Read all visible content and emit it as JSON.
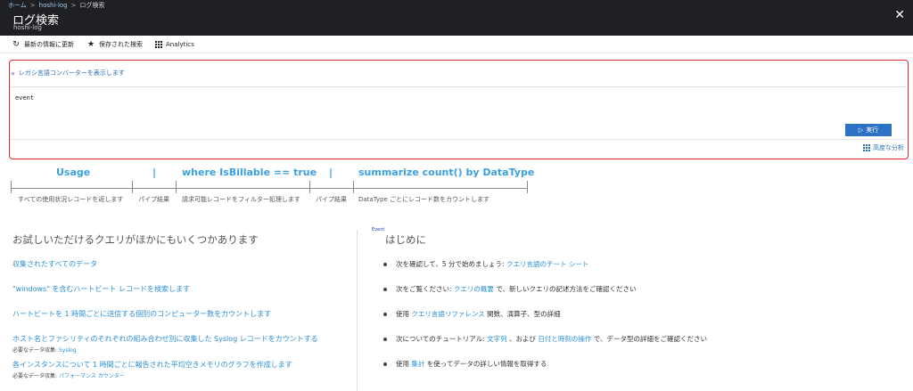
{
  "breadcrumb": {
    "home": "ホーム",
    "sep": ">",
    "workspace": "hoshi-log",
    "current": "ログ検索"
  },
  "header": {
    "title": "ログ検索",
    "subtitle": "hoshi-log",
    "close_icon": "close-icon"
  },
  "toolbar": {
    "refresh_label": "最新の情報に更新",
    "saved_label": "保存された検索",
    "analytics_label": "Analytics"
  },
  "query": {
    "legacy_toggle": "レガシ言語コンバーターを表示します",
    "text": "event",
    "run_label": "実行",
    "advanced_label": "高度な分析"
  },
  "syntax": {
    "parts": [
      "Usage",
      "|",
      "where IsBillable == true",
      "|",
      "summarize count() by DataType"
    ],
    "descriptions": [
      "すべての使用状況レコードを返します",
      "パイプ結果",
      "請求可能レコードをフィルター処理します",
      "パイプ結果",
      "DataType ごとにレコード数をカウントします"
    ]
  },
  "samples": {
    "heading": "お試しいただけるクエリがほかにもいくつかあります",
    "items": [
      {
        "label": "収集されたすべてのデータ"
      },
      {
        "label": "\"windows\" を含むハートビート レコードを検索します"
      },
      {
        "label": "ハートビートを 1 時間ごとに送信する個別のコンピューター数をカウントします"
      },
      {
        "label": "ホスト名とファシリティのそれぞれの組み合わせ別に収集した Syslog レコードをカウントする",
        "req_prefix": "必要なデータ収集:",
        "req_value": "Syslog"
      },
      {
        "label": "各インスタンスについて 1 時間ごとに報告された平均空きメモリのグラフを作成します",
        "req_prefix": "必要なデータ収集:",
        "req_value": "パフォーマンス カウンター"
      }
    ]
  },
  "getting_started": {
    "tag": "Event",
    "heading": "はじめに",
    "items": [
      {
        "pre": "次を確認して、5 分で始めましょう:",
        "link": "クエリ言語のチート シート",
        "post": ""
      },
      {
        "pre": "次をご覧ください:",
        "link": "クエリの概要",
        "post": "で、新しいクエリの記述方法をご確認ください"
      },
      {
        "pre": "使用",
        "link": "クエリ言語リファレンス",
        "post": "関数、演算子、型の詳細"
      },
      {
        "pre": "次についてのチュートリアル:",
        "link": "文字列",
        "mid": "、および",
        "link2": "日付と時刻の操作",
        "post": "で、データ型の詳細をご確認ください"
      },
      {
        "pre": "使用",
        "link": "集計",
        "post": "を使ってデータの詳しい情報を取得する"
      }
    ]
  },
  "colors": {
    "topbar": "#1f2023",
    "accent": "#2d72c4",
    "link": "#2a8fd6",
    "highlight_border": "#e0262e",
    "syntax": "#3aa0df"
  }
}
